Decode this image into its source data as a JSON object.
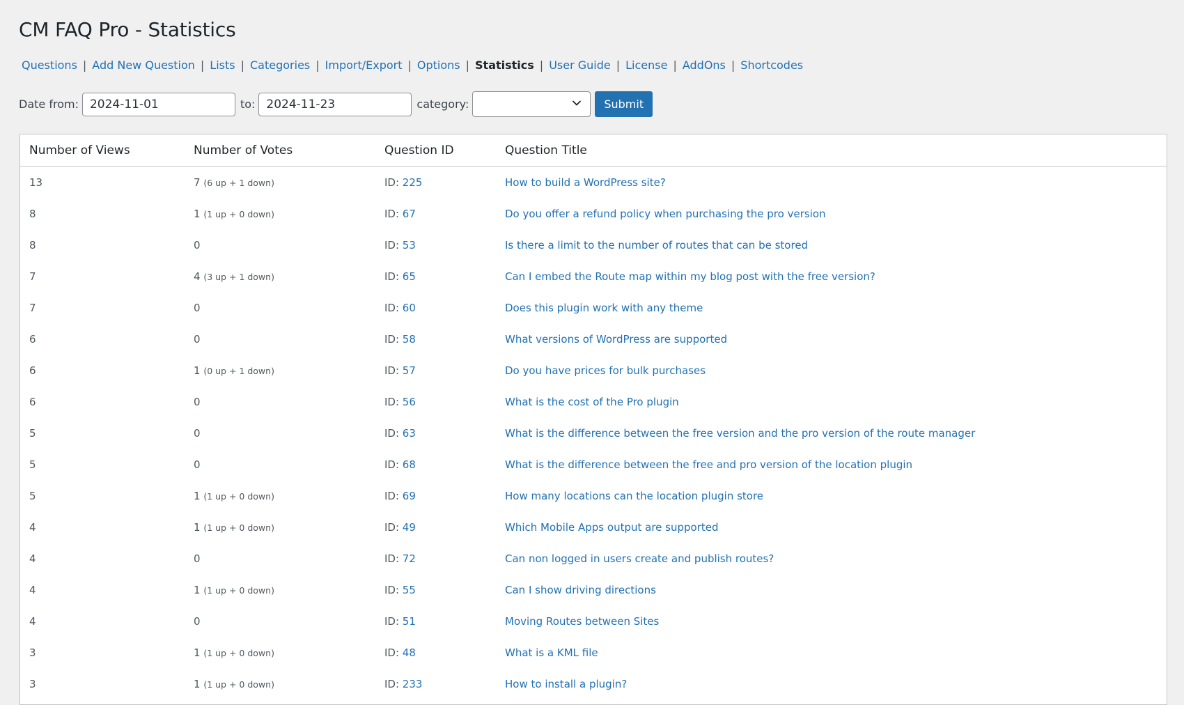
{
  "page": {
    "title": "CM FAQ Pro - Statistics"
  },
  "nav": {
    "items": [
      {
        "label": "Questions",
        "current": false
      },
      {
        "label": "Add New Question",
        "current": false
      },
      {
        "label": "Lists",
        "current": false
      },
      {
        "label": "Categories",
        "current": false
      },
      {
        "label": "Import/Export",
        "current": false
      },
      {
        "label": "Options",
        "current": false
      },
      {
        "label": "Statistics",
        "current": true
      },
      {
        "label": "User Guide",
        "current": false
      },
      {
        "label": "License",
        "current": false
      },
      {
        "label": "AddOns",
        "current": false
      },
      {
        "label": "Shortcodes",
        "current": false
      }
    ],
    "separator": "|"
  },
  "filters": {
    "date_from_label": "Date from:",
    "date_from_value": "2024-11-01",
    "to_label": "to:",
    "date_to_value": "2024-11-23",
    "category_label": "category:",
    "category_value": "",
    "submit_label": "Submit"
  },
  "table": {
    "headers": [
      "Number of Views",
      "Number of Votes",
      "Question ID",
      "Question Title"
    ],
    "id_prefix": "ID: ",
    "rows": [
      {
        "views": "13",
        "votes": "7",
        "votes_detail": "(6 up + 1 down)",
        "id": "225",
        "title": "How to build a WordPress site?"
      },
      {
        "views": "8",
        "votes": "1",
        "votes_detail": "(1 up + 0 down)",
        "id": "67",
        "title": "Do you offer a refund policy when purchasing the pro version"
      },
      {
        "views": "8",
        "votes": "0",
        "votes_detail": "",
        "id": "53",
        "title": "Is there a limit to the number of routes that can be stored"
      },
      {
        "views": "7",
        "votes": "4",
        "votes_detail": "(3 up + 1 down)",
        "id": "65",
        "title": "Can I embed the Route map within my blog post with the free version?"
      },
      {
        "views": "7",
        "votes": "0",
        "votes_detail": "",
        "id": "60",
        "title": "Does this plugin work with any theme"
      },
      {
        "views": "6",
        "votes": "0",
        "votes_detail": "",
        "id": "58",
        "title": "What versions of WordPress are supported"
      },
      {
        "views": "6",
        "votes": "1",
        "votes_detail": "(0 up + 1 down)",
        "id": "57",
        "title": "Do you have prices for bulk purchases"
      },
      {
        "views": "6",
        "votes": "0",
        "votes_detail": "",
        "id": "56",
        "title": "What is the cost of the Pro plugin"
      },
      {
        "views": "5",
        "votes": "0",
        "votes_detail": "",
        "id": "63",
        "title": "What is the difference between the free version and the pro version of the route manager"
      },
      {
        "views": "5",
        "votes": "0",
        "votes_detail": "",
        "id": "68",
        "title": "What is the difference between the free and pro version of the location plugin"
      },
      {
        "views": "5",
        "votes": "1",
        "votes_detail": "(1 up + 0 down)",
        "id": "69",
        "title": "How many locations can the location plugin store"
      },
      {
        "views": "4",
        "votes": "1",
        "votes_detail": "(1 up + 0 down)",
        "id": "49",
        "title": "Which Mobile Apps output are supported"
      },
      {
        "views": "4",
        "votes": "0",
        "votes_detail": "",
        "id": "72",
        "title": "Can non logged in users create and publish routes?"
      },
      {
        "views": "4",
        "votes": "1",
        "votes_detail": "(1 up + 0 down)",
        "id": "55",
        "title": "Can I show driving directions"
      },
      {
        "views": "4",
        "votes": "0",
        "votes_detail": "",
        "id": "51",
        "title": "Moving Routes between Sites"
      },
      {
        "views": "3",
        "votes": "1",
        "votes_detail": "(1 up + 0 down)",
        "id": "48",
        "title": "What is a KML file"
      },
      {
        "views": "3",
        "votes": "1",
        "votes_detail": "(1 up + 0 down)",
        "id": "233",
        "title": "How to install a plugin?"
      }
    ]
  }
}
